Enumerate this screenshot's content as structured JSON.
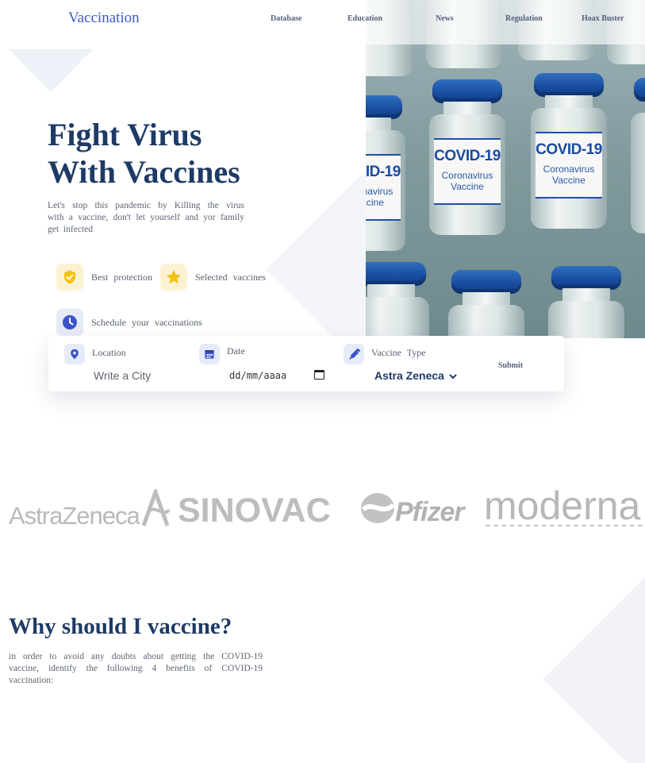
{
  "header": {
    "brand": "Vaccination",
    "nav": [
      "Database",
      "Education",
      "News",
      "Regulation",
      "Hoax Buster"
    ]
  },
  "hero": {
    "title_line1": "Fight Virus",
    "title_line2": "With Vaccines",
    "description": "Let's stop this pandemic by Killing the virus with a vaccine, don't let yourself and yor family get infected",
    "features": [
      {
        "label": "Best protection",
        "icon": "shield-check-icon"
      },
      {
        "label": "Selected vaccines",
        "icon": "star-icon"
      },
      {
        "label": "Schedule your vaccinations",
        "icon": "clock-icon"
      }
    ],
    "photo_vial_label": "COVID-19",
    "photo_vial_sublabel": "Coronavirus Vaccine"
  },
  "booking": {
    "location_label": "Location",
    "location_placeholder": "Write a City",
    "date_label": "Date",
    "date_value": "dd/mm/aaaa",
    "vaccine_label": "Vaccine Type",
    "vaccine_selected": "Astra Zeneca",
    "submit_label": "Submit"
  },
  "partners": [
    "AstraZeneca",
    "SINOVAC",
    "Pfizer",
    "moderna"
  ],
  "why": {
    "title": "Why should I vaccine?",
    "description": "in order to avoid any doubts about getting the COVID-19 vaccine, identify the following 4 benefits of COVID-19 vaccination:"
  },
  "colors": {
    "brand_blue": "#3a5bc7",
    "heading_navy": "#1e3a66",
    "accent_yellow": "#f6c10f",
    "icon_blue": "#3b55c9"
  }
}
